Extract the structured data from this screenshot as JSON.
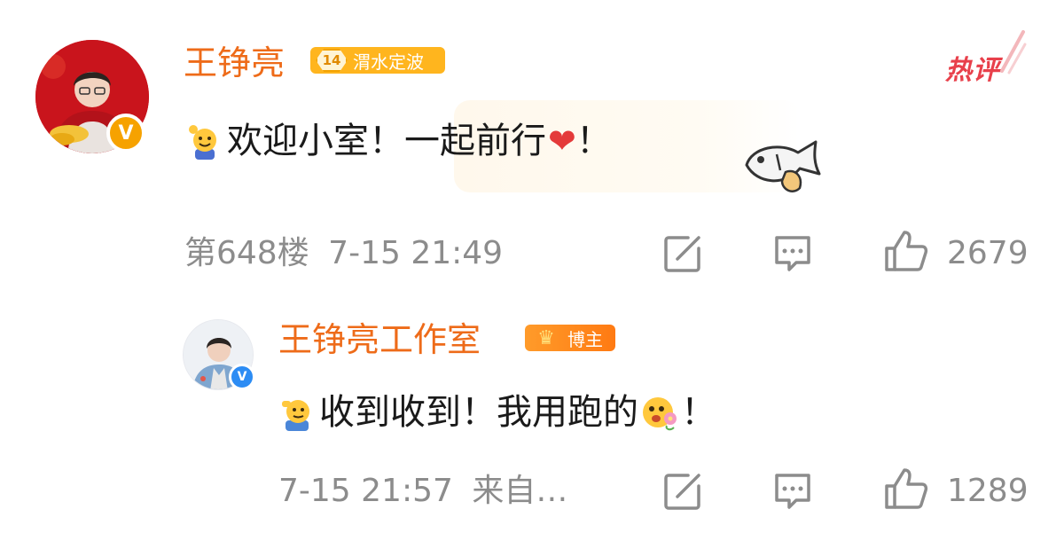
{
  "comment": {
    "author_name": "王铮亮",
    "fan_level": "14",
    "fan_badge_label": "渭水定波",
    "hot_tag": "热评",
    "text_part1": "欢迎小室！一起前行",
    "text_part2": "！",
    "floor": "第648楼",
    "time": "7-15 21:49",
    "like_count": "2679"
  },
  "reply": {
    "author_name": "王铮亮工作室",
    "role_badge_label": "博主",
    "text_part1": "收到收到！我用跑的",
    "text_part2": "！",
    "time": "7-15 21:57",
    "source": "来自…",
    "like_count": "1289"
  },
  "icons": {
    "verified_main": "orange-v-verified-icon",
    "verified_reply": "blue-v-verified-icon",
    "edit": "edit-icon",
    "reply": "comment-icon",
    "like": "thumbs-up-icon"
  },
  "colors": {
    "username": "#ee6b19",
    "hot_tag": "#e8404b",
    "meta": "#8c8c8c",
    "heart": "#e43a3a",
    "verify_orange": "#f6a200",
    "verify_blue": "#2c8cf4"
  }
}
